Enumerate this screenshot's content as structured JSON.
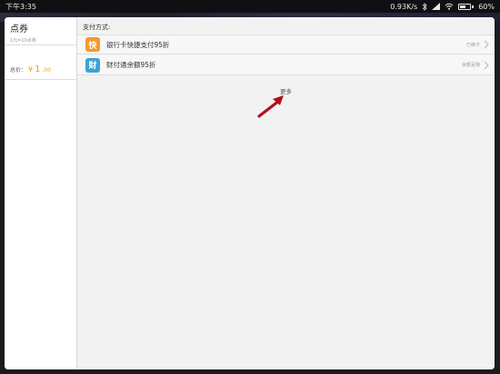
{
  "status_bar": {
    "time": "下午3:35",
    "network_speed": "0.93K/s",
    "battery_percent": "60%",
    "battery_level": 0.6,
    "icons": [
      "bluetooth-icon",
      "signal-icon",
      "wifi-icon",
      "battery-icon"
    ]
  },
  "left_panel": {
    "title": "点券",
    "subtitle": "1元=10点券",
    "total_label": "总价：",
    "total_currency": "¥",
    "total_int": "1",
    "total_dec": ".00"
  },
  "payment": {
    "section_title": "支付方式:",
    "methods": [
      {
        "icon_char": "快",
        "icon_name": "bank-card-quickpay-icon",
        "icon_color": "#f39a2e",
        "label": "银行卡快捷支付95折",
        "status": "已绑卡"
      },
      {
        "icon_char": "财",
        "icon_name": "tenpay-balance-icon",
        "icon_color": "#3aa3d6",
        "label": "财付通余额95折",
        "status": "余额足够"
      }
    ],
    "more_label": "更多"
  },
  "colors": {
    "accent_price": "#f0a21e",
    "annotation_arrow": "#b0111d"
  }
}
